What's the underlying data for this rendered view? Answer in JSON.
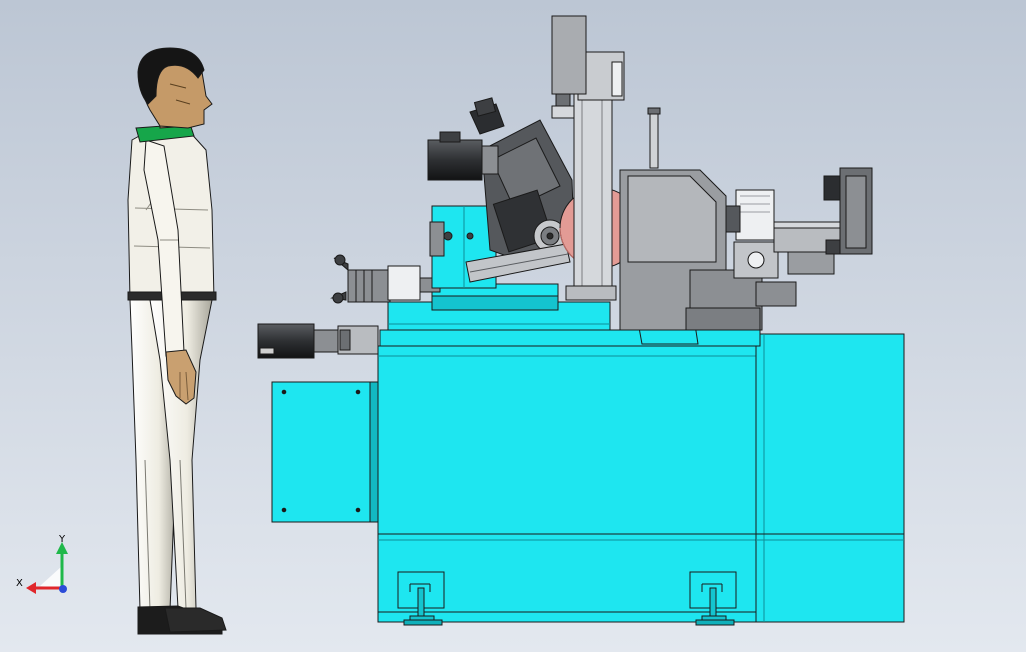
{
  "viewport": {
    "background_top": "#bcc6d4",
    "background_bottom": "#e3e8ef"
  },
  "colors": {
    "machine_cyan": "#1ee6f0",
    "machine_cyan_dark": "#12b8c2",
    "outline": "#1a1a1a",
    "steel_gray": "#8c8f93",
    "steel_dark": "#3d3f42",
    "wheel_red": "#e39b95",
    "figure_white": "#f0eee6",
    "figure_green": "#16a64a",
    "figure_skin": "#c9a070",
    "motor_white": "#eef0f2"
  },
  "triad": {
    "y_label": "Y",
    "x_label": "X",
    "y_color": "#1fb84a",
    "x_color": "#e0262b",
    "z_color": "#2b4bd8"
  }
}
